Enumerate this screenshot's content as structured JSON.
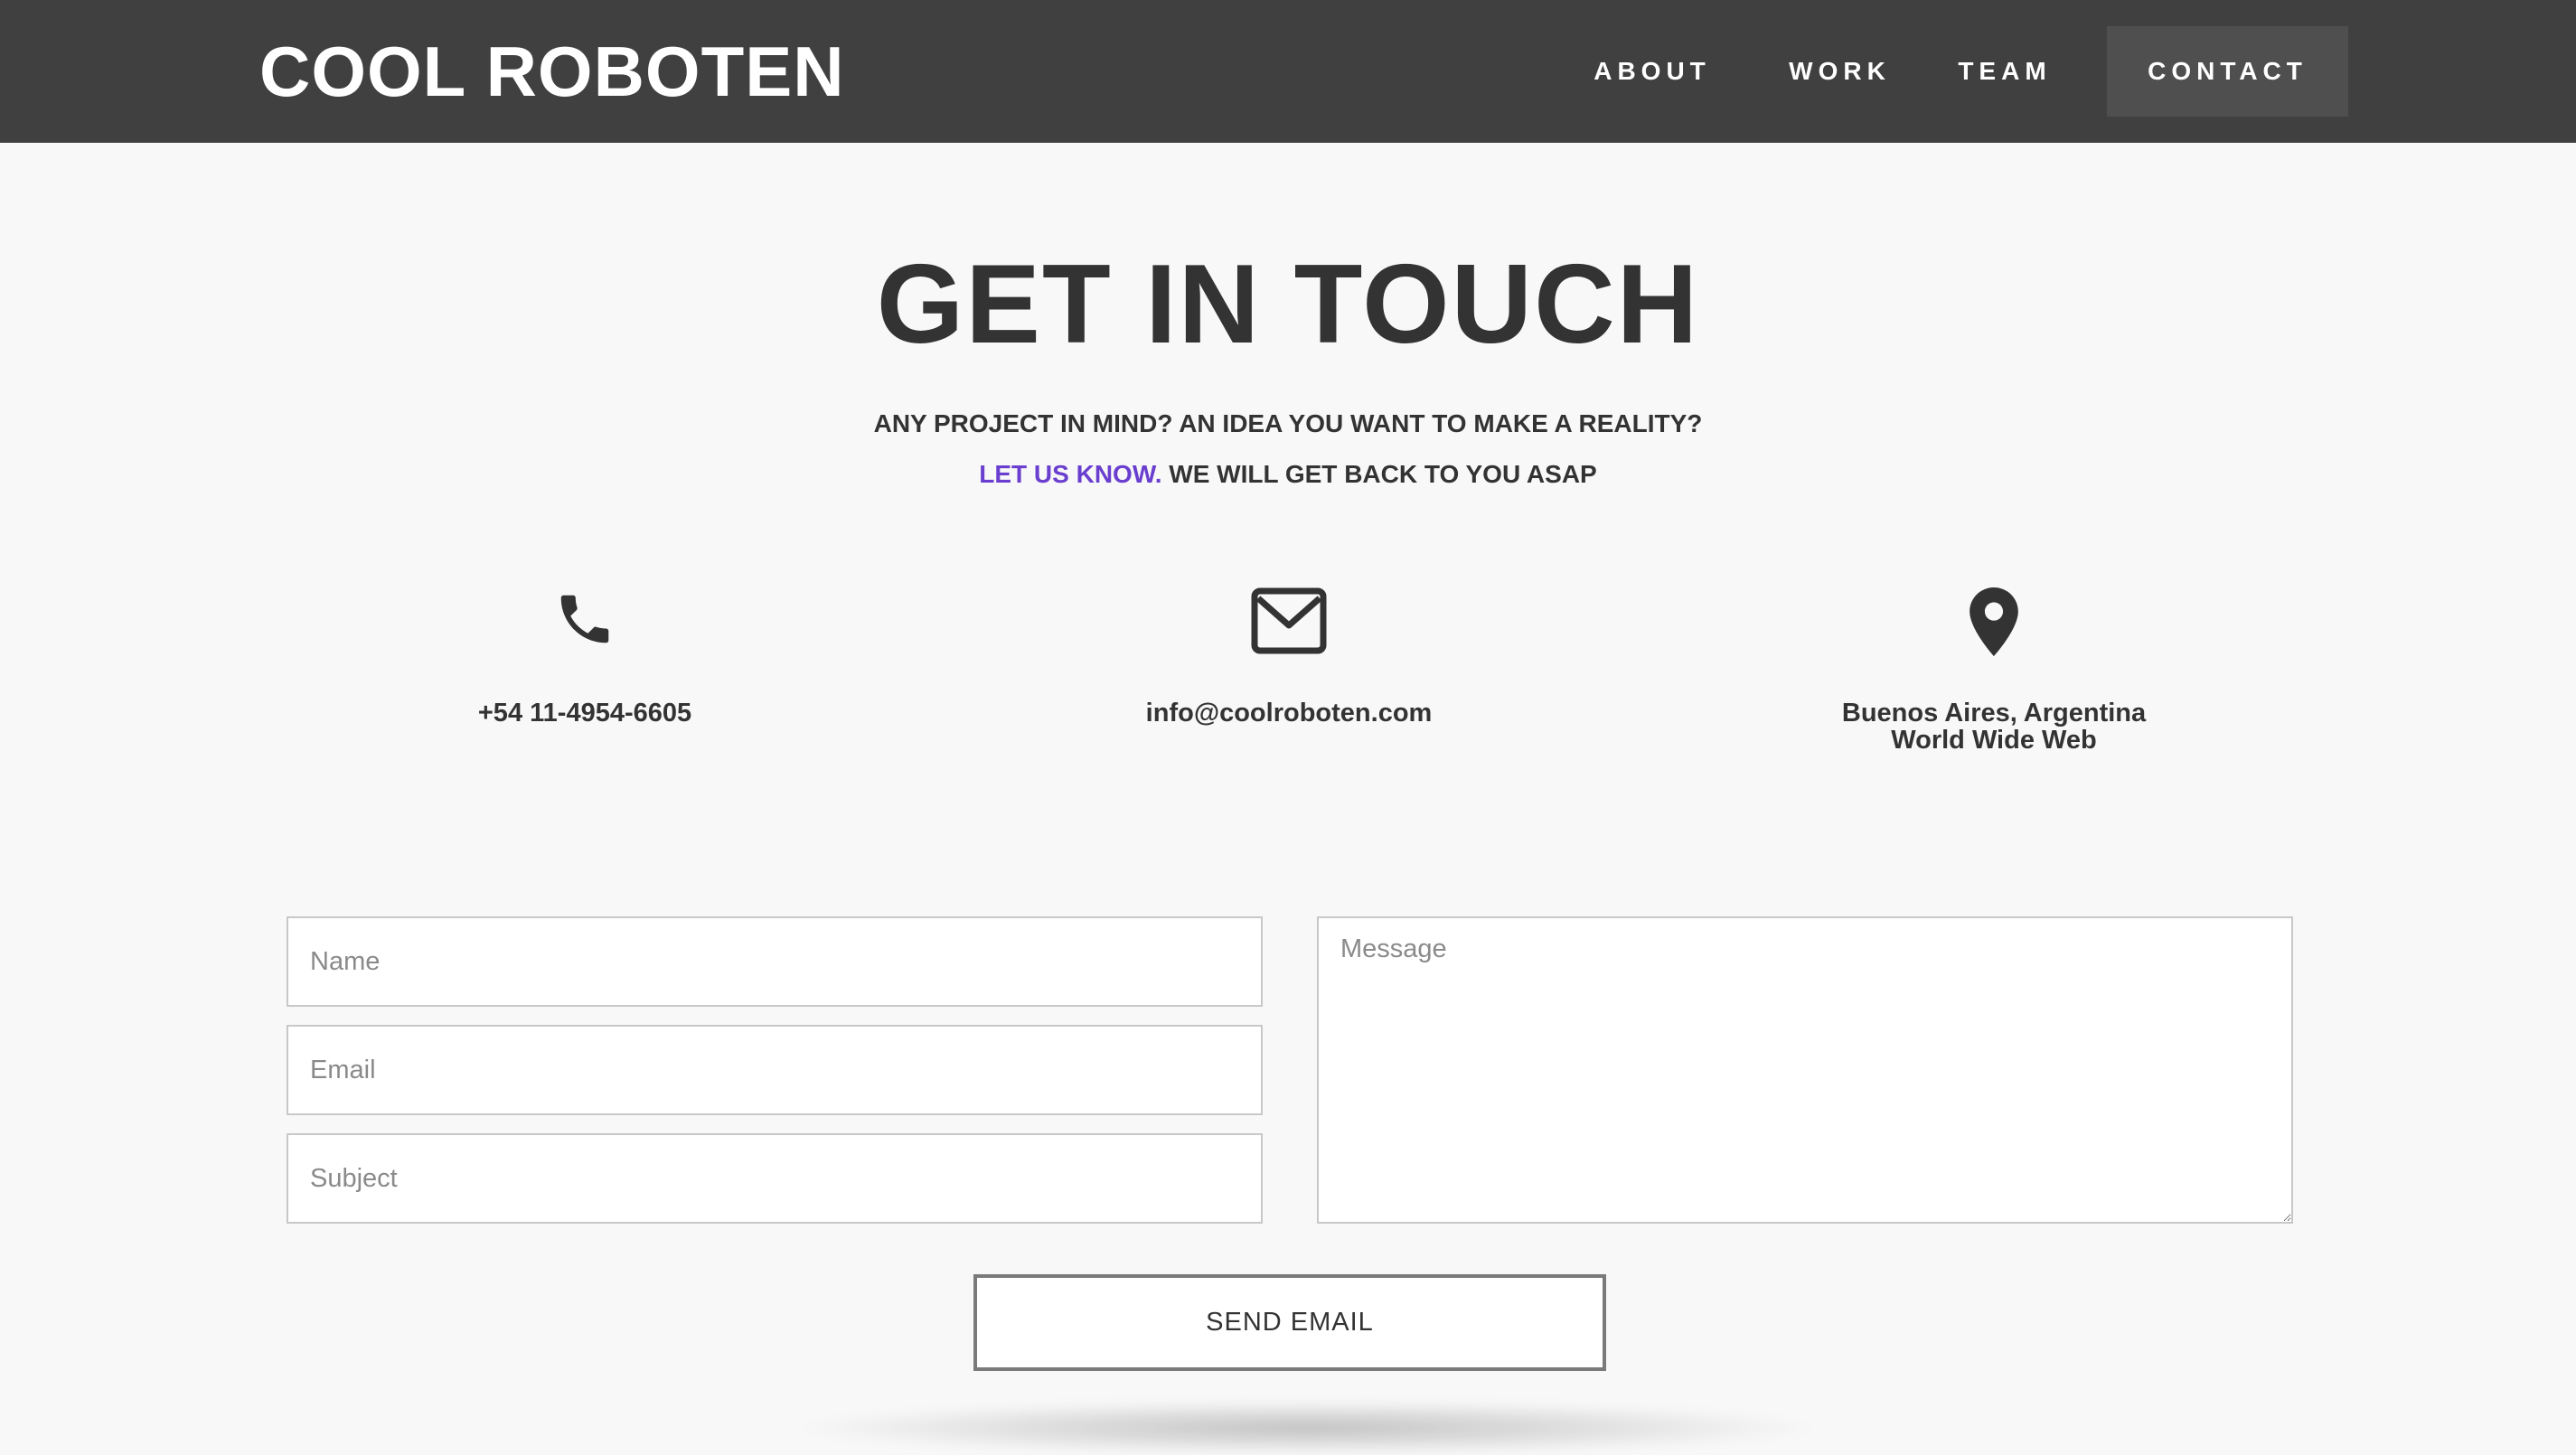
{
  "header": {
    "brand": "COOL ROBOTEN",
    "nav": [
      {
        "label": "ABOUT",
        "active": false
      },
      {
        "label": "WORK",
        "active": false
      },
      {
        "label": "TEAM",
        "active": false
      },
      {
        "label": "CONTACT",
        "active": true
      }
    ]
  },
  "hero": {
    "title": "GET IN TOUCH",
    "subtitle_line1": "ANY PROJECT IN MIND? AN IDEA YOU WANT TO MAKE A REALITY?",
    "subtitle_link": "LET US KNOW.",
    "subtitle_line2_rest": "WE WILL GET BACK TO YOU ASAP"
  },
  "contact_info": {
    "phone": {
      "icon": "phone-icon",
      "text": "+54 11-4954-6605"
    },
    "email": {
      "icon": "envelope-icon",
      "text": "info@coolroboten.com"
    },
    "location": {
      "icon": "map-pin-icon",
      "line1": "Buenos Aires, Argentina",
      "line2": "World Wide Web"
    }
  },
  "form": {
    "name_placeholder": "Name",
    "email_placeholder": "Email",
    "subject_placeholder": "Subject",
    "message_placeholder": "Message",
    "submit_label": "SEND EMAIL"
  },
  "colors": {
    "header_bg": "#404040",
    "active_nav_bg": "#4f4f4f",
    "page_bg": "#f8f8f8",
    "text": "#333333",
    "accent": "#6a3fcf"
  }
}
